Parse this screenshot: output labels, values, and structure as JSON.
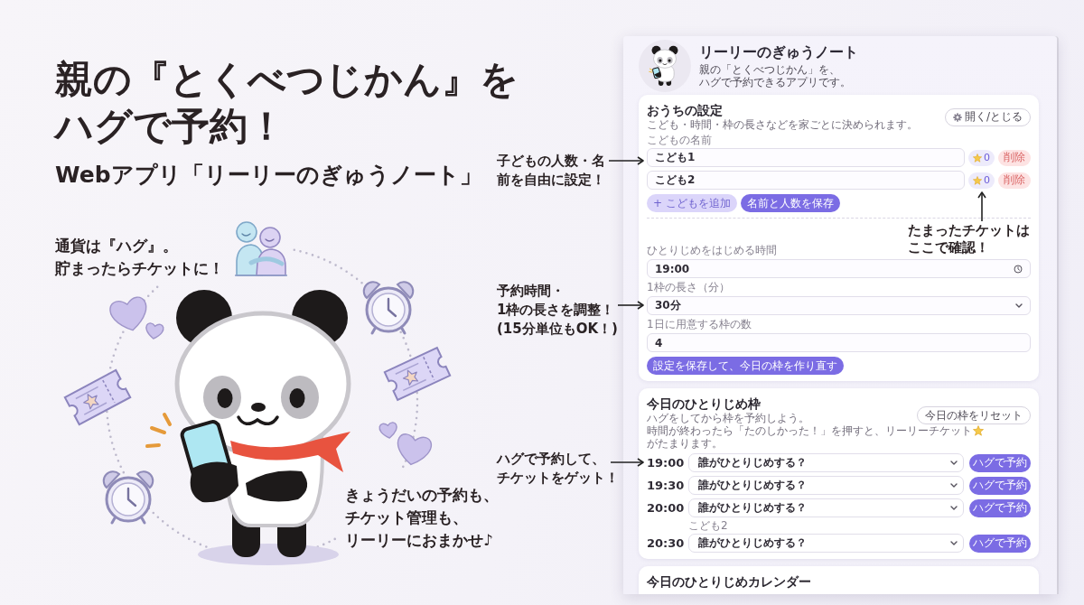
{
  "headline": {
    "lines": [
      "親の『とくべつじかん』を",
      "ハグで予約！"
    ],
    "subtitle": "Webアプリ「リーリーのぎゅうノート」"
  },
  "illustration": {
    "captions": [
      {
        "lines": [
          "通貨は『ハグ』。",
          "貯まったらチケットに！"
        ]
      },
      {
        "lines": [
          "きょうだいの予約も、",
          "チケット管理も、",
          "リーリーにおまかせ♪"
        ]
      }
    ]
  },
  "callouts": [
    {
      "lines": [
        "子どもの人数・名",
        "前を自由に設定！"
      ],
      "kind": "right"
    },
    {
      "lines": [
        "予約時間・",
        "1枠の長さを調整！",
        "(15分単位もOK！)"
      ],
      "kind": "right"
    },
    {
      "lines": [
        "ハグで予約して、",
        "チケットをゲット！"
      ],
      "kind": "right"
    },
    {
      "lines": [
        "たまったチケットは",
        "ここで確認！"
      ],
      "kind": "up"
    }
  ],
  "app": {
    "title": "リーリーのぎゅうノート",
    "tagline": [
      "親の「とくべつじかん」を、",
      "ハグで予約できるアプリです。"
    ],
    "settings": {
      "title": "おうちの設定",
      "description": "こども・時間・枠の長さなどを家ごとに決められます。",
      "toggle_button": "開く/とじる",
      "children_label": "こどもの名前",
      "children": [
        {
          "name": "こども1",
          "tickets": "0",
          "delete_button": "削除"
        },
        {
          "name": "こども2",
          "tickets": "0",
          "delete_button": "削除"
        }
      ],
      "buttons": [
        {
          "label": "+ こどもを追加",
          "kind": "secondary"
        },
        {
          "label": "名前と人数を保存",
          "kind": "primary"
        }
      ],
      "fields": [
        {
          "label": "ひとりじめをはじめる時間",
          "value": "19:00",
          "kind": "time"
        },
        {
          "label": "1枠の長さ（分）",
          "value": "30分",
          "kind": "select"
        },
        {
          "label": "1日に用意する枠の数",
          "value": "4",
          "kind": "number"
        }
      ],
      "save_button": "設定を保存して、今日の枠を作り直す"
    },
    "today": {
      "title": "今日のひとりじめ枠",
      "hint": "ハグをしてから枠を予約しよう。",
      "rule": {
        "before": "時間が終わったら「たのしかった！」を押すと、リーリーチケット",
        "after": "がたまります。"
      },
      "reset_button": "今日の枠をリセット",
      "slots": [
        {
          "time": "19:00",
          "value": "誰がひとりじめする？",
          "button": "ハグで予約"
        },
        {
          "time": "19:30",
          "value": "誰がひとりじめする？",
          "button": "ハグで予約"
        },
        {
          "time": "20:00",
          "value": "誰がひとりじめする？",
          "button": "ハグで予約",
          "note": "こども2"
        },
        {
          "time": "20:30",
          "value": "誰がひとりじめする？",
          "button": "ハグで予約"
        }
      ]
    },
    "calendar": {
      "title": "今日のひとりじめカレンダー"
    }
  }
}
